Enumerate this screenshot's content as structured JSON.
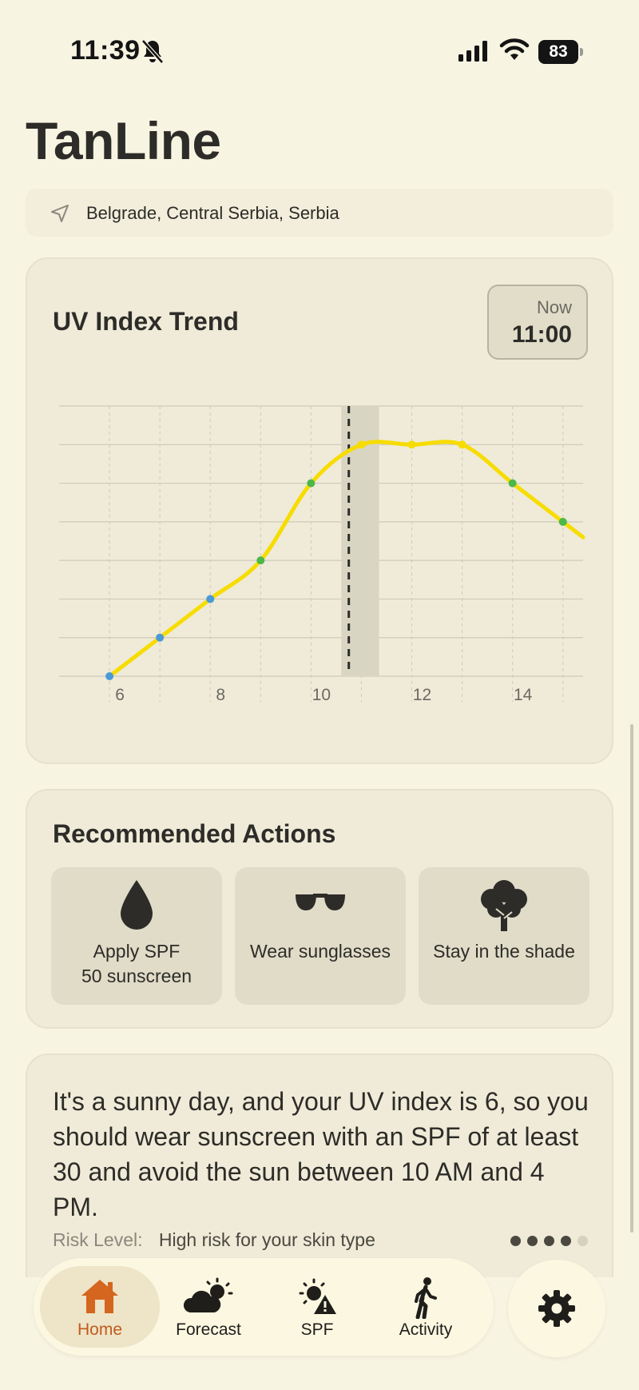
{
  "status_bar": {
    "time": "11:39",
    "battery": "83"
  },
  "app": {
    "title": "TanLine"
  },
  "location": {
    "text": "Belgrade, Central Serbia, Serbia"
  },
  "uv_card": {
    "title": "UV Index Trend",
    "now_label": "Now",
    "now_time": "11:00"
  },
  "chart_data": {
    "type": "line",
    "title": "UV Index Trend",
    "x": [
      6,
      7,
      8,
      9,
      10,
      11,
      12,
      13,
      14,
      15
    ],
    "x_ticks": [
      "6",
      "8",
      "10",
      "12",
      "14"
    ],
    "xlim": [
      5,
      15.4
    ],
    "y": [
      0,
      1,
      2,
      3,
      5,
      6,
      6,
      6,
      5,
      4
    ],
    "ylim": [
      0,
      7
    ],
    "y_gridlines": 7,
    "y_tick_labels_shown": false,
    "current_x": 10.75,
    "current_band": [
      10.6,
      11.35
    ],
    "point_colors": {
      "low": "#4a9ad8",
      "moderate": "#4cb84a"
    },
    "line_color": "#f7dc00",
    "grid": true
  },
  "actions_card": {
    "title": "Recommended Actions",
    "items": [
      {
        "label_line1": "Apply SPF",
        "label_line2": "50 sunscreen",
        "icon": "droplet-icon"
      },
      {
        "label_line1": "Wear sunglasses",
        "label_line2": "",
        "icon": "sunglasses-icon"
      },
      {
        "label_line1": "Stay in the shade",
        "label_line2": "",
        "icon": "tree-icon"
      }
    ]
  },
  "message_card": {
    "text": "It's a sunny day, and your UV index is 6, so you should wear sunscreen with an SPF of at least 30 and avoid the sun between 10 AM and 4 PM.",
    "risk_label": "Risk Level:",
    "risk_value": "High risk for your skin type",
    "page_count": 5,
    "page_active": 3
  },
  "tab_bar": {
    "tabs": [
      {
        "label": "Home",
        "icon": "house-icon",
        "active": true
      },
      {
        "label": "Forecast",
        "icon": "cloud-sun-icon",
        "active": false
      },
      {
        "label": "SPF",
        "icon": "sun-warning-icon",
        "active": false
      },
      {
        "label": "Activity",
        "icon": "walking-person-icon",
        "active": false
      }
    ],
    "settings_icon": "gear-icon"
  },
  "colors": {
    "background": "#f8f4e2",
    "card": "#efebd8",
    "accent": "#c15a1c",
    "chart_line": "#f7dc00"
  }
}
